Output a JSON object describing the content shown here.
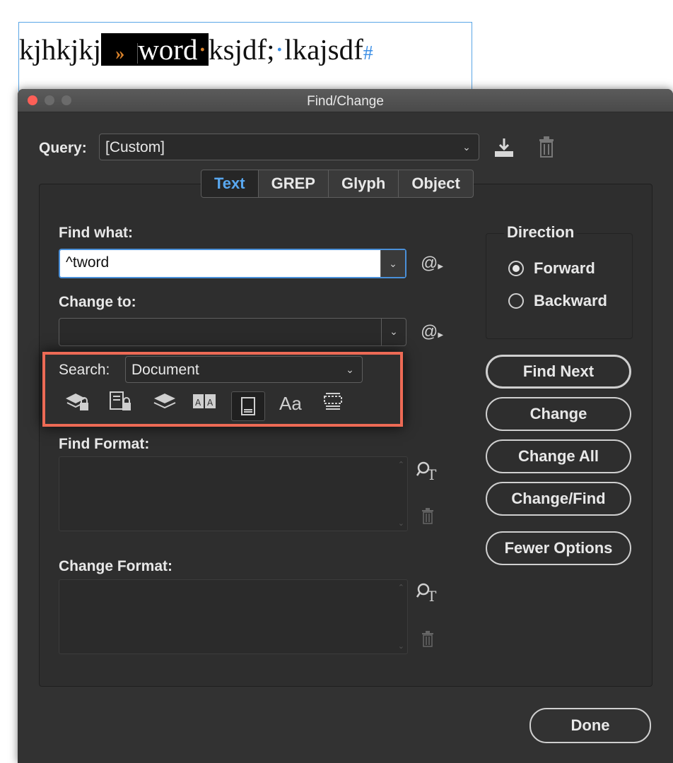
{
  "document": {
    "text_before": "kjhkjkj",
    "tab_marker": "»",
    "selected_word": "word",
    "space_marker": "·",
    "text_after": "ksjdf;",
    "space_marker2": "·",
    "text_end": "lkajsdf",
    "end_marker": "#"
  },
  "dialog": {
    "title": "Find/Change",
    "query_label": "Query:",
    "query_value": "[Custom]",
    "tabs": [
      {
        "label": "Text",
        "active": true
      },
      {
        "label": "GREP",
        "active": false
      },
      {
        "label": "Glyph",
        "active": false
      },
      {
        "label": "Object",
        "active": false
      }
    ],
    "find_what_label": "Find what:",
    "find_what_value": "^tword",
    "change_to_label": "Change to:",
    "change_to_value": "",
    "search_label": "Search:",
    "search_value": "Document",
    "aa_label": "Aa",
    "find_format_label": "Find Format:",
    "change_format_label": "Change Format:",
    "direction": {
      "title": "Direction",
      "forward": "Forward",
      "backward": "Backward",
      "selected": "Forward"
    },
    "buttons": {
      "find_next": "Find Next",
      "change": "Change",
      "change_all": "Change All",
      "change_find": "Change/Find",
      "fewer_options": "Fewer Options",
      "done": "Done"
    },
    "colors": {
      "accent": "#59a8f0",
      "highlight_box": "#ed6a55",
      "close_button": "#fd5f57"
    }
  }
}
